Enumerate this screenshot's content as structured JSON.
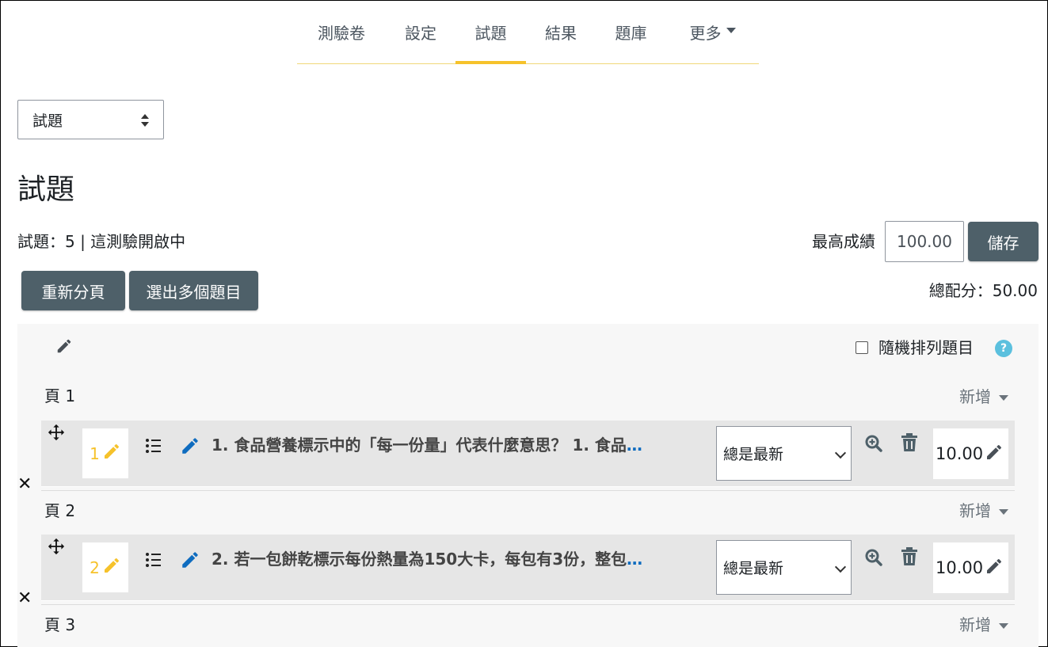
{
  "tabs": [
    {
      "label": "測驗卷"
    },
    {
      "label": "設定"
    },
    {
      "label": "試題"
    },
    {
      "label": "結果"
    },
    {
      "label": "題庫"
    },
    {
      "label": "更多"
    }
  ],
  "nav_select": {
    "value": "試題"
  },
  "page_title": "試題",
  "info": "試題：5 | 這測驗開啟中",
  "max_grade": {
    "label": "最高成績",
    "value": "100.00",
    "save_label": "儲存"
  },
  "buttons": {
    "repaginate": "重新分頁",
    "select_multiple": "選出多個題目"
  },
  "total_marks": "總配分：50.00",
  "shuffle_label": "隨機排列題目",
  "add_label": "新增",
  "pages": [
    {
      "label": "頁 1"
    },
    {
      "label": "頁 2"
    },
    {
      "label": "頁 3"
    }
  ],
  "questions": [
    {
      "number": "1",
      "text": "1. 食品營養標示中的「每一份量」代表什麼意思？ 1. 食品",
      "ellipsis": "…",
      "version": "總是最新",
      "mark": "10.00"
    },
    {
      "number": "2",
      "text": "2. 若一包餅乾標示每份熱量為150大卡，每包有3份，整包",
      "ellipsis": "…",
      "version": "總是最新",
      "mark": "10.00"
    }
  ],
  "colors": {
    "accent": "#f6c22b",
    "button": "#4e6069",
    "link": "#0f6cbf",
    "help": "#5bc0de"
  },
  "remove_symbol": "✕"
}
